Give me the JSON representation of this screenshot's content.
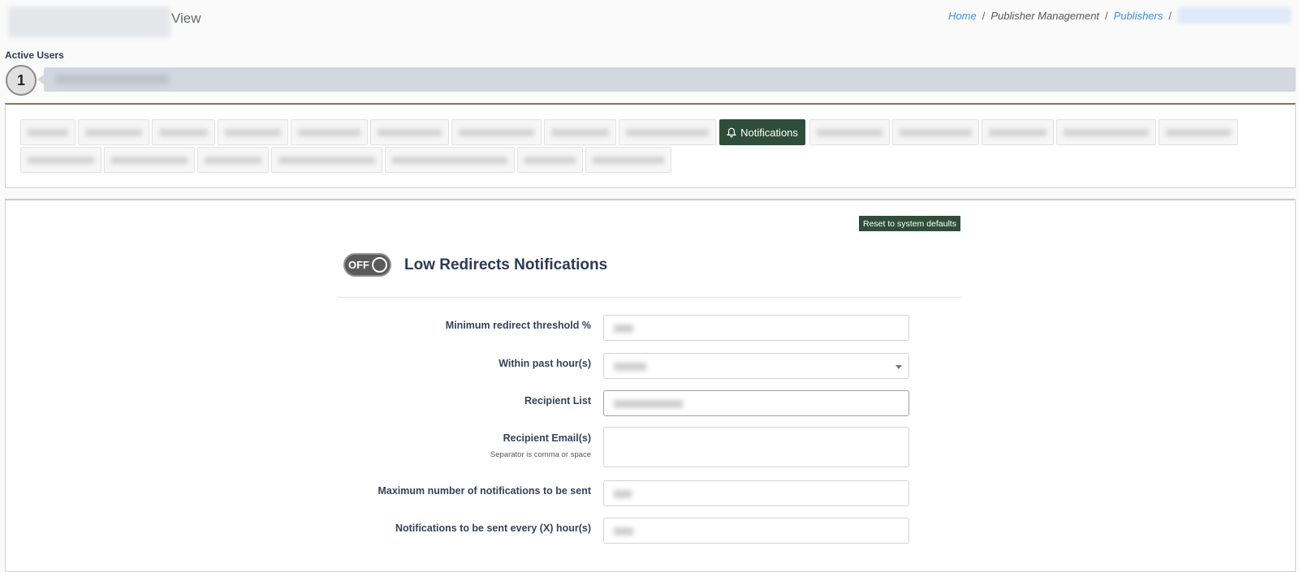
{
  "header": {
    "title_suffix": "View",
    "breadcrumb": {
      "home": "Home",
      "management": "Publisher Management",
      "publishers": "Publishers",
      "separator": "/"
    }
  },
  "active_users": {
    "label": "Active Users",
    "count": "1"
  },
  "tabs": {
    "active_label": "Notifications",
    "active_icon": "bell-icon"
  },
  "notifications": {
    "reset_button": "Reset to system defaults",
    "toggle_state": "OFF",
    "section_title": "Low Redirects Notifications",
    "fields": {
      "min_threshold_label": "Minimum redirect threshold %",
      "within_hours_label": "Within past hour(s)",
      "recipient_list_label": "Recipient List",
      "recipient_emails_label": "Recipient Email(s)",
      "recipient_emails_help": "Separator is comma or space",
      "max_notifications_label": "Maximum number of notifications to be sent",
      "every_x_hours_label": "Notifications to be sent every (X) hour(s)"
    }
  },
  "colors": {
    "accent_green": "#2f4e3a",
    "link_blue": "#3a8ee6",
    "panel_border_top": "#8d6d5b"
  }
}
